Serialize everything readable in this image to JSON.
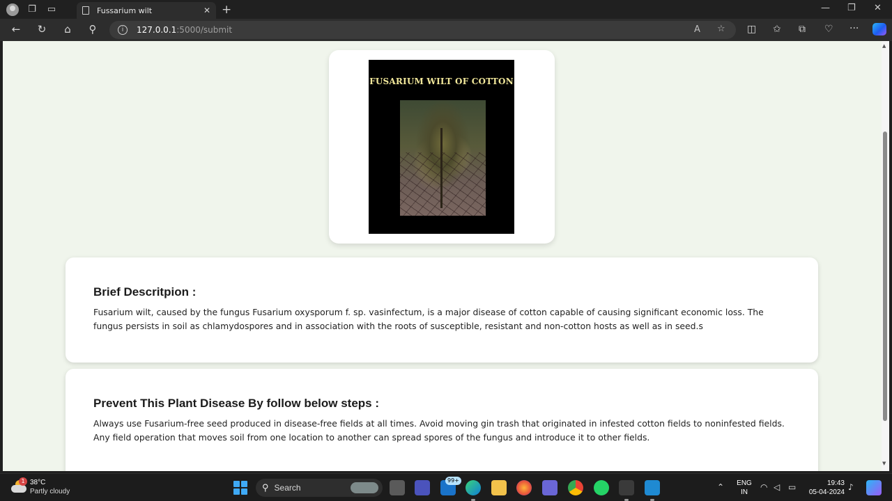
{
  "browser": {
    "tab_title": "Fussarium wilt",
    "url_host": "127.0.0.1",
    "url_path": ":5000/submit"
  },
  "page": {
    "image_card": {
      "poster_title": "FUSARIUM WILT OF COTTON"
    },
    "description": {
      "heading": "Brief Descritpion :",
      "text": "Fusarium wilt, caused by the fungus Fusarium oxysporum f. sp. vasinfectum, is a major disease of cotton capable of causing significant economic loss. The fungus persists in soil as chlamydospores and in association with the roots of susceptible, resistant and non-cotton hosts as well as in seed.s"
    },
    "prevention": {
      "heading": "Prevent This Plant Disease By follow below steps :",
      "text": "Always use Fusarium-free seed produced in disease-free fields at all times. Avoid moving gin trash that originated in infested cotton fields to noninfested fields. Any field operation that moves soil from one location to another can spread spores of the fungus and introduce it to other fields."
    }
  },
  "taskbar": {
    "weather_temp": "38°C",
    "weather_condition": "Partly cloudy",
    "weather_badge": "1",
    "search_label": "Search",
    "mail_badge": "99+",
    "lang_line1": "ENG",
    "lang_line2": "IN",
    "time": "19:43",
    "date": "05-04-2024"
  },
  "colors": {
    "page_background": "#f0f5ec",
    "card_background": "#ffffff",
    "browser_chrome": "#202020"
  }
}
